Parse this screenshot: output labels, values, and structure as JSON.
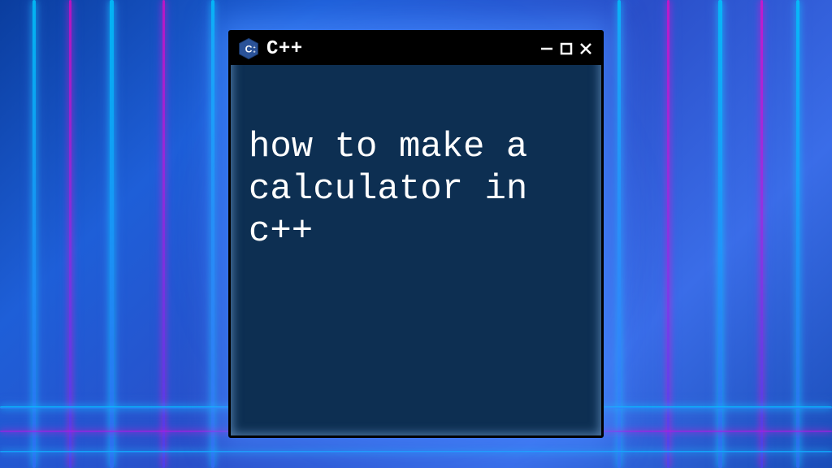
{
  "window": {
    "title": "C++",
    "icon_name": "cpp-icon",
    "minimize_label": "-",
    "maximize_label": "□",
    "close_label": "×"
  },
  "terminal": {
    "text": "how to make a calculator in c++"
  },
  "colors": {
    "window_bg": "#0d2f52",
    "titlebar_bg": "#000000",
    "text": "#ffffff"
  }
}
